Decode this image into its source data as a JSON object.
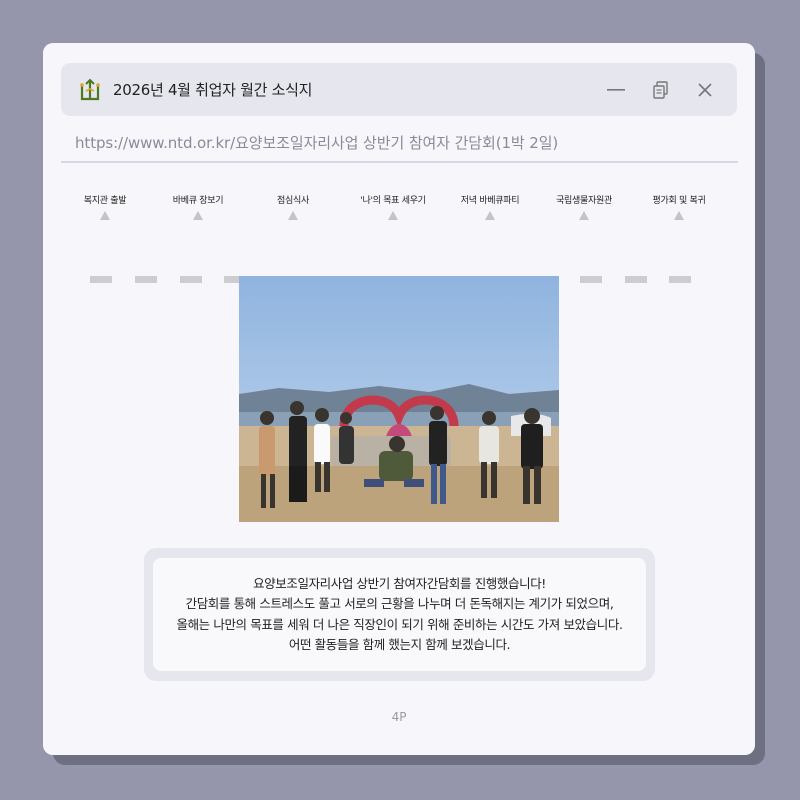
{
  "window": {
    "title": "2026년 4월 취업자 월간 소식지",
    "url": "https://www.ntd.or.kr/요양보조일자리사업 상반기 참여자 간담회(1박 2일)",
    "controls": [
      "minimize-icon",
      "restore-icon",
      "close-icon"
    ]
  },
  "timeline": {
    "steps": [
      {
        "label": "복지관 출발"
      },
      {
        "label": "바베큐 장보기"
      },
      {
        "label": "점심식사"
      },
      {
        "label": "'나'의 목표 세우기"
      },
      {
        "label": "저녁 바베큐파티"
      },
      {
        "label": "국립생물자원관"
      },
      {
        "label": "평가회 및 복귀"
      }
    ]
  },
  "photo": {
    "icon": "group-photo-image"
  },
  "paragraph": {
    "lines": [
      "요양보조일자리사업 상반기 참여자간담회를 진행했습니다!",
      "간담회를 통해 스트레스도 풀고 서로의 근황을 나누며 더 돈독해지는 계기가 되었으며,",
      "올해는 나만의 목표를 세워 더 나은 직장인이 되기 위해 준비하는 시간도 가져 보았습니다.",
      "어떤 활동들을 함께 했는지 함께 보겠습니다."
    ]
  },
  "page": {
    "number": "4P"
  },
  "colors": {
    "background": "#9596ab",
    "window": "#f7f7fb",
    "titlebar": "#e6e6ee",
    "logo": "#4c7a1e"
  }
}
